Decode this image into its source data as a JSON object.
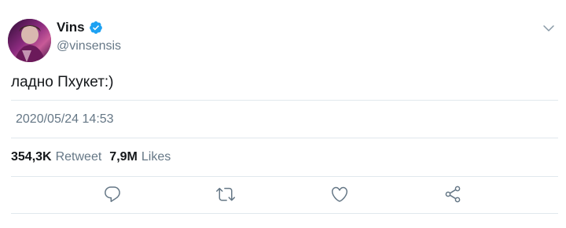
{
  "author": {
    "display_name": "Vins",
    "handle": "@vinsensis",
    "verified": true,
    "verified_icon": "verified-badge-icon",
    "avatar": "profile-avatar"
  },
  "tweet": {
    "text": "ладно Пхукет:)",
    "timestamp": "2020/05/24 14:53"
  },
  "stats": {
    "retweets_count": "354,3K",
    "retweets_label": "Retweet",
    "likes_count": "7,9M",
    "likes_label": "Likes"
  },
  "actions": [
    {
      "name": "reply",
      "icon": "reply-icon"
    },
    {
      "name": "retweet",
      "icon": "retweet-icon"
    },
    {
      "name": "like",
      "icon": "heart-icon"
    },
    {
      "name": "share",
      "icon": "share-icon"
    }
  ],
  "colors": {
    "text_primary": "#14171a",
    "text_secondary": "#657786",
    "verified_blue": "#1da1f2",
    "divider": "#e1e8ed"
  }
}
